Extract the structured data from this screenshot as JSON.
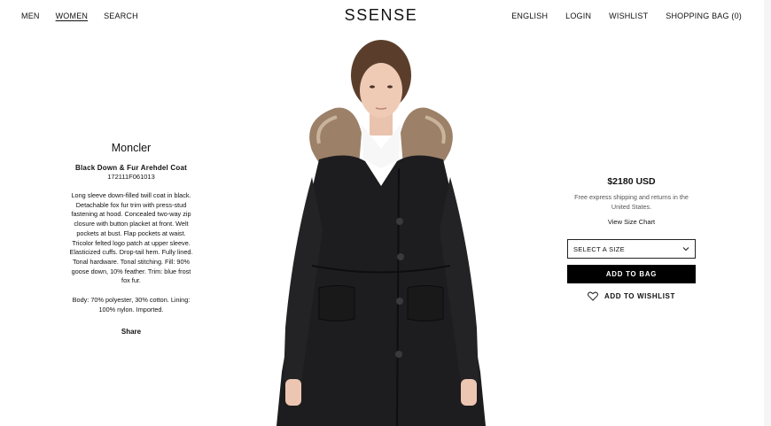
{
  "header": {
    "nav_left": [
      "MEN",
      "WOMEN",
      "SEARCH"
    ],
    "logo": "SSENSE",
    "nav_right": [
      "ENGLISH",
      "LOGIN",
      "WISHLIST",
      "SHOPPING BAG (0)"
    ]
  },
  "product": {
    "brand": "Moncler",
    "name": "Black Down & Fur Arehdel Coat",
    "code": "172111F061013",
    "description": "Long sleeve down-filled twill coat in black. Detachable fox fur trim with press-stud fastening at hood. Concealed two-way zip closure with button placket at front. Welt pockets at bust. Flap pockets at waist. Tricolor felted logo patch at upper sleeve. Elasticized cuffs. Drop-tail hem. Fully lined. Tonal hardware. Tonal stitching. Fill: 90% goose down, 10% feather. Trim: blue frost fox fur.",
    "composition": "Body: 70% polyester, 30% cotton. Lining: 100% nylon. Imported.",
    "share_label": "Share"
  },
  "purchase": {
    "price": "$2180 USD",
    "shipping_note": "Free express shipping and returns in the United States.",
    "size_chart_label": "View Size Chart",
    "size_select_value": "SELECT A SIZE",
    "add_to_bag_label": "ADD TO BAG",
    "add_to_wishlist_label": "ADD TO WISHLIST"
  },
  "image": {
    "icon": "product-photo-coat"
  }
}
